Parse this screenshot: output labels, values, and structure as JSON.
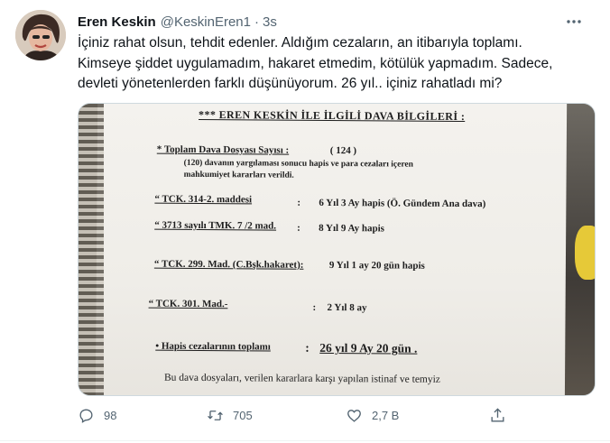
{
  "tweet": {
    "author_name": "Eren Keskin",
    "handle": "@KeskinEren1",
    "separator": "·",
    "time": "3s",
    "text_lines": [
      "İçiniz rahat olsun, tehdit edenler. Aldığım cezaların, an itibarıyla toplamı.",
      "Kimseye şiddet uygulamadım, hakaret etmedim, kötülük yapmadım. Sadece,",
      "devleti yönetenlerden farklı düşünüyorum. 26 yıl.. içiniz rahatladı mi?"
    ]
  },
  "document": {
    "title": "*** EREN KESKİN İLE İLGİLİ DAVA BİLGİLERİ :",
    "total_label": "* Toplam Dava Dosyası Sayısı :",
    "total_value": "( 124 )",
    "note_line1": "(120) davanın yargılaması sonucu hapis ve para cezaları içeren",
    "note_line2": "mahkumiyet kararları verildi.",
    "rows": [
      {
        "law": "“ TCK. 314-2. maddesi",
        "colon": ":",
        "sentence": "6 Yıl 3 Ay hapis (Ö. Gündem Ana dava)"
      },
      {
        "law": "“ 3713 sayılı TMK. 7 /2 mad.",
        "colon": ":",
        "sentence": "8 Yıl 9 Ay hapis"
      },
      {
        "law": "“ TCK. 299. Mad. (C.Bşk.hakaret):",
        "colon": "",
        "sentence": "9 Yıl 1 ay 20 gün hapis"
      },
      {
        "law": "“ TCK. 301. Mad.-",
        "colon": ":",
        "sentence": "2 Yıl 8 ay"
      }
    ],
    "sum_label": "• Hapis cezalarının toplamı",
    "sum_colon": ":",
    "sum_value": "26 yıl 9 Ay 20 gün .",
    "footer_line": "Bu dava dosyaları, verilen kararlara karşı yapılan istinaf ve temyiz"
  },
  "actions": {
    "reply_count": "98",
    "retweet_count": "705",
    "like_count": "2,7 B"
  },
  "colors": {
    "text": "#0f1419",
    "secondary": "#536471",
    "border": "#cfd9de"
  },
  "icons": [
    "more-icon",
    "reply-icon",
    "retweet-icon",
    "like-icon",
    "share-icon"
  ]
}
